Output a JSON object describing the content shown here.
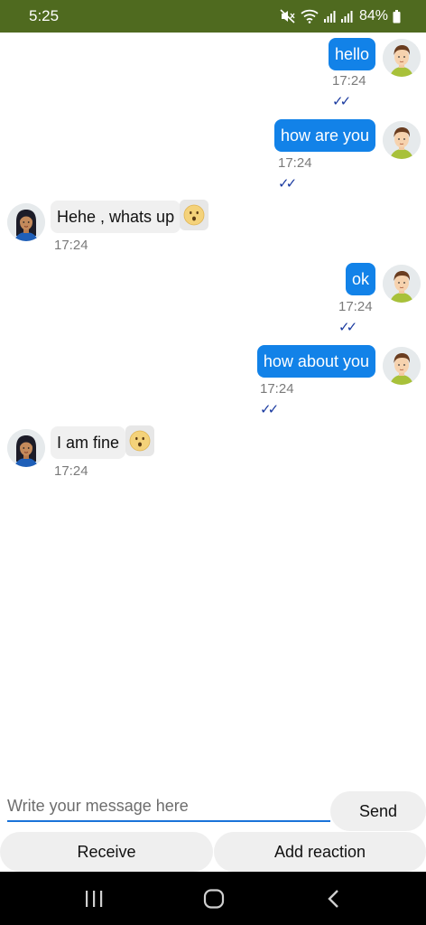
{
  "status_bar": {
    "time": "5:25",
    "battery": "84%",
    "icons": [
      "mute-icon",
      "wifi-icon",
      "signal-icon",
      "signal-icon",
      "battery-icon"
    ]
  },
  "messages": [
    {
      "direction": "outgoing",
      "text": "hello",
      "time": "17:24",
      "ticks": "✓✓"
    },
    {
      "direction": "outgoing",
      "text": "how are you",
      "time": "17:24",
      "ticks": "✓✓"
    },
    {
      "direction": "incoming",
      "text": "Hehe , whats up",
      "time": "17:24",
      "reaction": "surprised-face-icon"
    },
    {
      "direction": "outgoing",
      "text": "ok",
      "time": "17:24",
      "ticks": "✓✓"
    },
    {
      "direction": "outgoing",
      "text": "how about you",
      "time": "17:24",
      "ticks": "✓✓"
    },
    {
      "direction": "incoming",
      "text": "I am fine",
      "time": "17:24",
      "reaction": "surprised-face-icon"
    }
  ],
  "composer": {
    "placeholder": "Write your message here",
    "value": "",
    "send_label": "Send"
  },
  "actions": {
    "receive_label": "Receive",
    "add_reaction_label": "Add reaction"
  },
  "colors": {
    "status_bar": "#4f6a1f",
    "outgoing_bubble": "#1282e8",
    "incoming_bubble": "#f0f0f0",
    "ticks": "#1a3aa0",
    "input_underline": "#1a73d9"
  }
}
